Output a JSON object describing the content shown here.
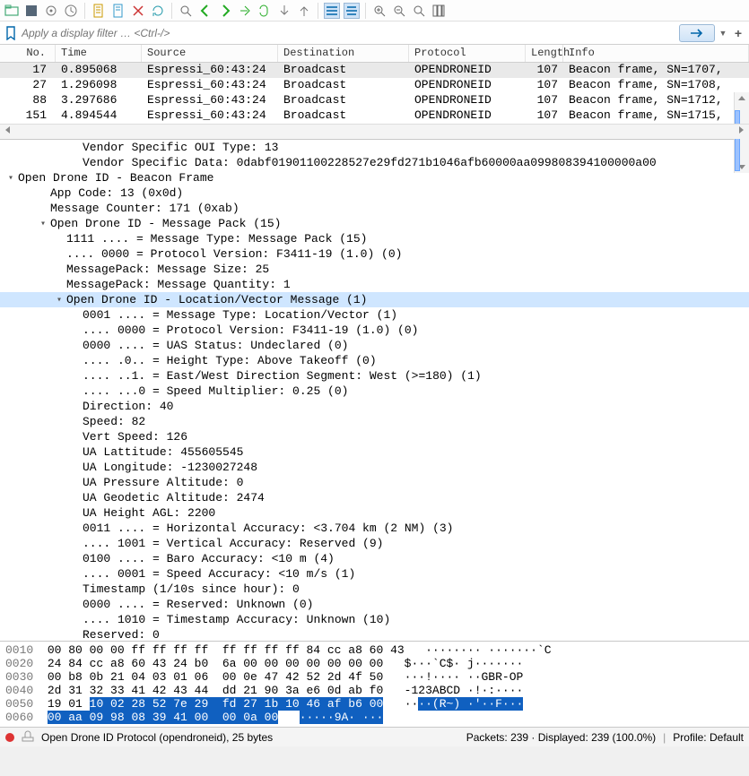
{
  "toolbar": {
    "icons": [
      "folder-icon",
      "square-icon",
      "target-icon",
      "clock-icon",
      "beaker-icon",
      "page-icon",
      "doc-icon",
      "x-icon",
      "refresh-icon",
      "search-icon",
      "back-icon",
      "forward-icon",
      "step-icon",
      "loop-icon",
      "down-icon",
      "up-icon",
      "bars-left-icon",
      "bars-center-icon",
      "zoom-in-icon",
      "zoom-out-icon",
      "zoom-reset-icon",
      "columns-icon"
    ]
  },
  "filter": {
    "placeholder": "Apply a display filter … <Ctrl-/>"
  },
  "columns": {
    "no": "No.",
    "time": "Time",
    "source": "Source",
    "destination": "Destination",
    "protocol": "Protocol",
    "length": "Length",
    "info": "Info"
  },
  "rows": [
    {
      "no": "17",
      "time": "0.895068",
      "src": "Espressi_60:43:24",
      "dst": "Broadcast",
      "proto": "OPENDRONEID",
      "len": "107",
      "info": "Beacon frame, SN=1707, ",
      "sel": true
    },
    {
      "no": "27",
      "time": "1.296098",
      "src": "Espressi_60:43:24",
      "dst": "Broadcast",
      "proto": "OPENDRONEID",
      "len": "107",
      "info": "Beacon frame, SN=1708, "
    },
    {
      "no": "88",
      "time": "3.297686",
      "src": "Espressi_60:43:24",
      "dst": "Broadcast",
      "proto": "OPENDRONEID",
      "len": "107",
      "info": "Beacon frame, SN=1712, "
    },
    {
      "no": "151",
      "time": "4.894544",
      "src": "Espressi_60:43:24",
      "dst": "Broadcast",
      "proto": "OPENDRONEID",
      "len": "107",
      "info": "Beacon frame, SN=1715, "
    }
  ],
  "tree": [
    {
      "indent": 4,
      "caret": "",
      "text": "Vendor Specific OUI Type: 13"
    },
    {
      "indent": 4,
      "caret": "",
      "text": "Vendor Specific Data: 0dabf01901100228527e29fd271b1046afb60000aa099808394100000a00"
    },
    {
      "indent": 0,
      "caret": "v",
      "text": "Open Drone ID - Beacon Frame"
    },
    {
      "indent": 2,
      "caret": "",
      "text": "App Code: 13 (0x0d)"
    },
    {
      "indent": 2,
      "caret": "",
      "text": "Message Counter: 171 (0xab)"
    },
    {
      "indent": 2,
      "caret": "v",
      "text": "Open Drone ID - Message Pack (15)"
    },
    {
      "indent": 3,
      "caret": "",
      "text": "1111 .... = Message Type: Message Pack (15)"
    },
    {
      "indent": 3,
      "caret": "",
      "text": ".... 0000 = Protocol Version: F3411-19 (1.0) (0)"
    },
    {
      "indent": 3,
      "caret": "",
      "text": "MessagePack: Message Size: 25"
    },
    {
      "indent": 3,
      "caret": "",
      "text": "MessagePack: Message Quantity: 1"
    },
    {
      "indent": 3,
      "caret": "v",
      "text": "Open Drone ID - Location/Vector Message (1)",
      "hl": true
    },
    {
      "indent": 4,
      "caret": "",
      "text": "0001 .... = Message Type: Location/Vector (1)"
    },
    {
      "indent": 4,
      "caret": "",
      "text": ".... 0000 = Protocol Version: F3411-19 (1.0) (0)"
    },
    {
      "indent": 4,
      "caret": "",
      "text": "0000 .... = UAS Status: Undeclared (0)"
    },
    {
      "indent": 4,
      "caret": "",
      "text": ".... .0.. = Height Type: Above Takeoff (0)"
    },
    {
      "indent": 4,
      "caret": "",
      "text": ".... ..1. = East/West Direction Segment: West (>=180) (1)"
    },
    {
      "indent": 4,
      "caret": "",
      "text": ".... ...0 = Speed Multiplier: 0.25 (0)"
    },
    {
      "indent": 4,
      "caret": "",
      "text": "Direction: 40"
    },
    {
      "indent": 4,
      "caret": "",
      "text": "Speed: 82"
    },
    {
      "indent": 4,
      "caret": "",
      "text": "Vert Speed: 126"
    },
    {
      "indent": 4,
      "caret": "",
      "text": "UA Lattitude: 455605545"
    },
    {
      "indent": 4,
      "caret": "",
      "text": "UA Longitude: -1230027248"
    },
    {
      "indent": 4,
      "caret": "",
      "text": "UA Pressure Altitude: 0"
    },
    {
      "indent": 4,
      "caret": "",
      "text": "UA Geodetic Altitude: 2474"
    },
    {
      "indent": 4,
      "caret": "",
      "text": "UA Height AGL: 2200"
    },
    {
      "indent": 4,
      "caret": "",
      "text": "0011 .... = Horizontal Accuracy: <3.704 km (2 NM) (3)"
    },
    {
      "indent": 4,
      "caret": "",
      "text": ".... 1001 = Vertical Accuracy: Reserved (9)"
    },
    {
      "indent": 4,
      "caret": "",
      "text": "0100 .... = Baro Accuracy: <10 m (4)"
    },
    {
      "indent": 4,
      "caret": "",
      "text": ".... 0001 = Speed Accuracy: <10 m/s (1)"
    },
    {
      "indent": 4,
      "caret": "",
      "text": "Timestamp (1/10s since hour): 0"
    },
    {
      "indent": 4,
      "caret": "",
      "text": "0000 .... = Reserved: Unknown (0)"
    },
    {
      "indent": 4,
      "caret": "",
      "text": ".... 1010 = Timestamp Accuracy: Unknown (10)"
    },
    {
      "indent": 4,
      "caret": "",
      "text": "Reserved: 0"
    }
  ],
  "hex": [
    {
      "off": "0010",
      "b": "00 80 00 00 ff ff ff ff  ff ff ff ff 84 cc a8 60 43",
      "a": "········ ·······`C"
    },
    {
      "off": "0020",
      "b": "24 84 cc a8 60 43 24 b0  6a 00 00 00 00 00 00 00",
      "a": "$···`C$· j·······"
    },
    {
      "off": "0030",
      "b": "00 b8 0b 21 04 03 01 06  00 0e 47 42 52 2d 4f 50",
      "a": "···!···· ··GBR-OP"
    },
    {
      "off": "0040",
      "b": "2d 31 32 33 41 42 43 44  dd 21 90 3a e6 0d ab f0",
      "a": "-123ABCD ·!·:····"
    },
    {
      "off": "0050",
      "b": "19 01 ",
      "bs": "10 02 28 52 7e 29  fd 27 1b 10 46 af b6 00",
      "a": "··",
      "as": "··(R~) ·'··F···"
    },
    {
      "off": "0060",
      "bs": "00 aa 09 98 08 39 41 00  00 0a 00",
      "a": "",
      "as": "·····9A· ···"
    }
  ],
  "status": {
    "left": "Open Drone ID Protocol (opendroneid), 25 bytes",
    "packets": "Packets: 239 · Displayed: 239 (100.0%)",
    "profile": "Profile: Default"
  }
}
